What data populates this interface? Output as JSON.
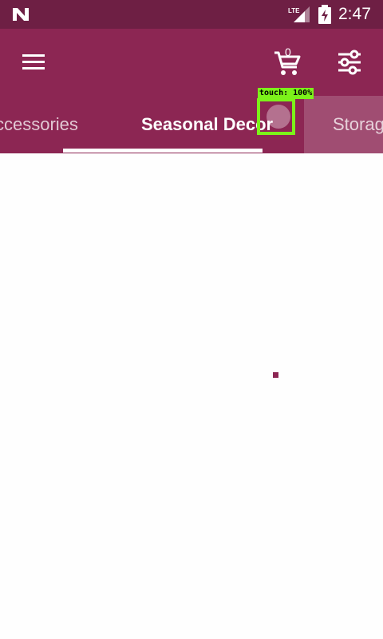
{
  "status_bar": {
    "time": "2:47",
    "network": "LTE",
    "icons": [
      "n-logo-icon",
      "lte-signal-icon",
      "battery-charging-icon"
    ]
  },
  "app_bar": {
    "menu_icon": "hamburger-menu-icon",
    "cart": {
      "icon": "shopping-cart-icon",
      "count": "0"
    },
    "filter_icon": "sliders-filter-icon"
  },
  "tabs": [
    {
      "label": "Accessories",
      "visible_text": "ccessories",
      "selected": false
    },
    {
      "label": "Seasonal Decor",
      "selected": true
    },
    {
      "label": "Storage",
      "visible_text": "Storag",
      "selected": false
    }
  ],
  "overlay": {
    "touch_label": "touch: 100%"
  },
  "colors": {
    "status_bar": "#6e1f44",
    "app_bar": "#8c2653",
    "touch_overlay": "#7cf21a",
    "indicator": "#ffffff"
  }
}
